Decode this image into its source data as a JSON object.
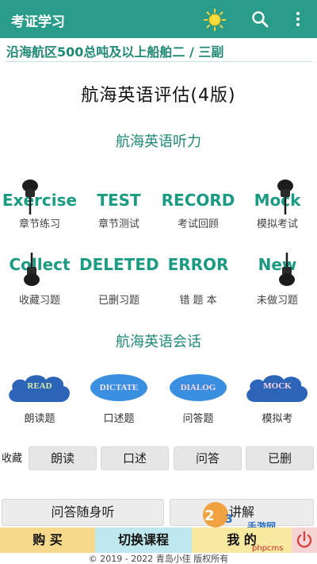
{
  "app_title": "考证学习",
  "subtitle": "沿海航区500总吨及以上船舶二 / 三副",
  "main_title": "航海英语评估(4版)",
  "listening": {
    "title": "航海英语听力",
    "tiles": [
      {
        "en": "Exercise",
        "zh": "章节练习"
      },
      {
        "en": "TEST",
        "zh": "章节测试"
      },
      {
        "en": "RECORD",
        "zh": "考试回顾"
      },
      {
        "en": "Mock",
        "zh": "模拟考试"
      },
      {
        "en": "Collect",
        "zh": "收藏习题"
      },
      {
        "en": "DELETED",
        "zh": "已删习题"
      },
      {
        "en": "ERROR",
        "zh": "错 题 本"
      },
      {
        "en": "New",
        "zh": "未做习题"
      }
    ]
  },
  "conversation": {
    "title": "航海英语会话",
    "items": [
      {
        "en": "READ",
        "zh": "朗读题"
      },
      {
        "en": "DICTATE",
        "zh": "口述题"
      },
      {
        "en": "DIALOG",
        "zh": "问答题"
      },
      {
        "en": "MOCK",
        "zh": "模拟考"
      }
    ]
  },
  "favorites": {
    "label": "收藏",
    "buttons": [
      "朗读",
      "口述",
      "问答",
      "已删"
    ]
  },
  "wide_buttons": {
    "left": "问答随身听",
    "right": "讲解"
  },
  "bottom_nav": {
    "buy": "购 买",
    "switch": "切换课程",
    "mine": "我 的"
  },
  "watermark": {
    "brand": "手游网",
    "tag": "phpcms"
  },
  "footer": "© 2019 - 2022 青岛小佳 版权所有",
  "colors": {
    "topbar": "#2a9d8a",
    "accent": "#1a9b82",
    "buy_bg": "#f6d98b",
    "switch_bg": "#bfe8ee",
    "mine_bg": "#f7e9a0",
    "power": "#d84242"
  }
}
